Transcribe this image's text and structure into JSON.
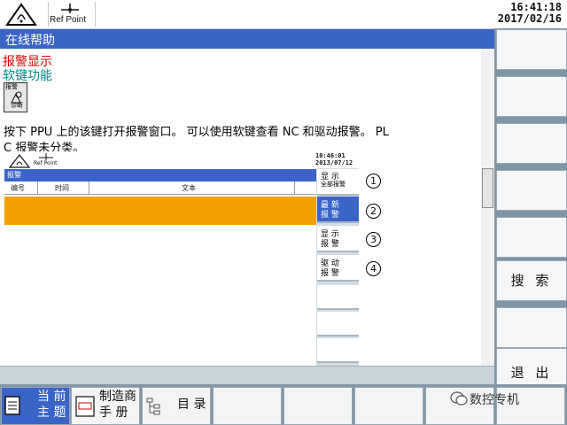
{
  "status_bar": {
    "refpoint_label": "Ref Point",
    "time": "16:41:18",
    "date": "2017/02/16"
  },
  "title": "在线帮助",
  "links": {
    "alarm": "报警显示",
    "softkey": "软键功能"
  },
  "diag_button": {
    "top": "报警",
    "bottom": "诊断"
  },
  "paragraph": {
    "line1": "按下 PPU 上的该键打开报警窗口。 可以使用软键查看 NC 和驱动报警。 PL",
    "line2": "C 报警未分类。"
  },
  "embedded_screen": {
    "refpoint_label": "Ref Point",
    "time": "10:46:01",
    "date": "2013/07/12",
    "title": "报警",
    "columns": [
      "编号",
      "时间",
      "文本"
    ],
    "softkeys": [
      {
        "line1": "显 示",
        "line2": "全部报警"
      },
      {
        "line1": "最 新",
        "line2": "报 警"
      },
      {
        "line1": "显 示",
        "line2": "报 警"
      },
      {
        "line1": "驱 动",
        "line2": "报 警"
      }
    ],
    "callouts": [
      "1",
      "2",
      "3",
      "4"
    ]
  },
  "right_softkeys": {
    "search": "搜 索",
    "exit": "退 出"
  },
  "bottom_softkeys": {
    "current_topic_1": "当 前",
    "current_topic_2": "主 题",
    "manual_1": "制造商",
    "manual_2": "手  册",
    "toc": "目 录"
  },
  "watermark": "数控专机",
  "colors": {
    "accent_blue": "#3a64c8",
    "alarm_orange": "#f5a000",
    "alarm_link_red": "#e00000",
    "softkey_link_teal": "#008a8a"
  }
}
